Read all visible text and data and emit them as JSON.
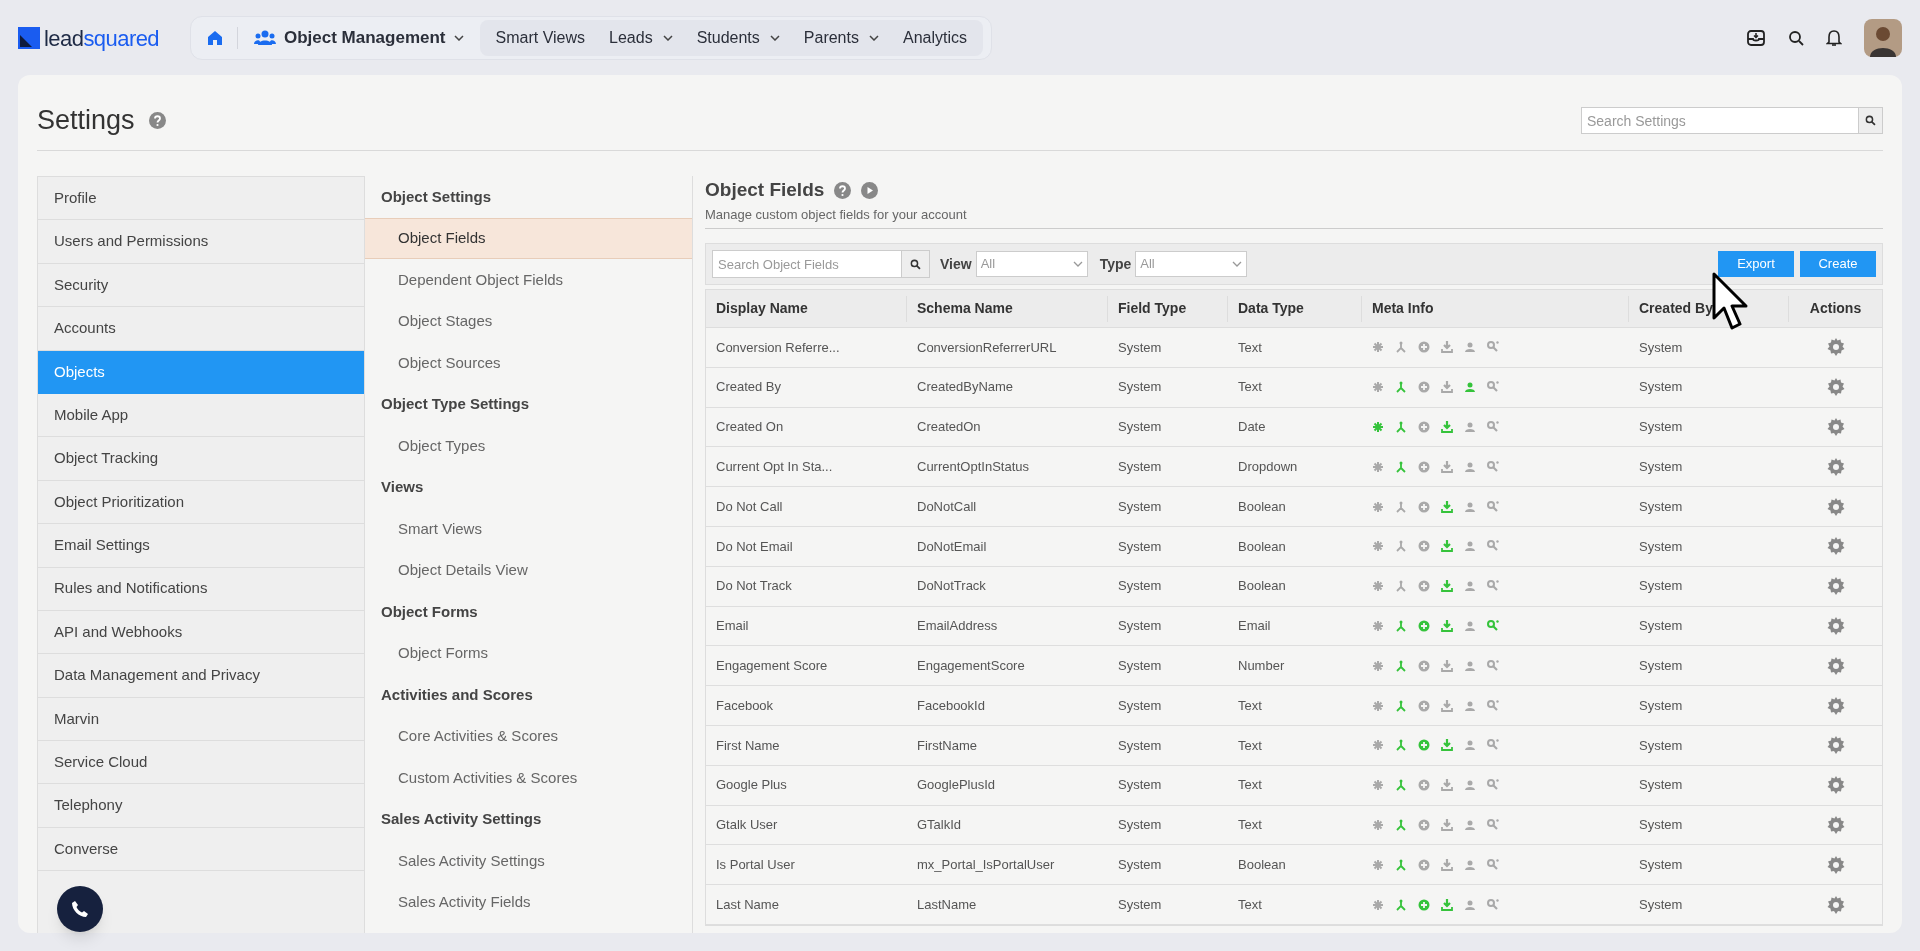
{
  "brand": {
    "part1": "lead",
    "part2": "squared"
  },
  "nav": {
    "module": "Object Management",
    "items": [
      {
        "label": "Smart Views",
        "dropdown": false
      },
      {
        "label": "Leads",
        "dropdown": true
      },
      {
        "label": "Students",
        "dropdown": true
      },
      {
        "label": "Parents",
        "dropdown": true
      },
      {
        "label": "Analytics",
        "dropdown": false
      }
    ]
  },
  "page": {
    "title": "Settings",
    "search": {
      "placeholder": "Search Settings"
    }
  },
  "sidebar": {
    "items": [
      {
        "label": "Profile",
        "selected": false
      },
      {
        "label": "Users and Permissions",
        "selected": false
      },
      {
        "label": "Security",
        "selected": false
      },
      {
        "label": "Accounts",
        "selected": false
      },
      {
        "label": "Objects",
        "selected": true
      },
      {
        "label": "Mobile App",
        "selected": false
      },
      {
        "label": "Object Tracking",
        "selected": false
      },
      {
        "label": "Object Prioritization",
        "selected": false
      },
      {
        "label": "Email Settings",
        "selected": false
      },
      {
        "label": "Rules and Notifications",
        "selected": false
      },
      {
        "label": "API and Webhooks",
        "selected": false
      },
      {
        "label": "Data Management and Privacy",
        "selected": false
      },
      {
        "label": "Marvin",
        "selected": false
      },
      {
        "label": "Service Cloud",
        "selected": false
      },
      {
        "label": "Telephony",
        "selected": false
      },
      {
        "label": "Converse",
        "selected": false
      }
    ]
  },
  "submenu": {
    "items": [
      {
        "kind": "heading",
        "label": "Object Settings"
      },
      {
        "kind": "item",
        "label": "Object Fields",
        "selected": true
      },
      {
        "kind": "item",
        "label": "Dependent Object Fields",
        "selected": false
      },
      {
        "kind": "item",
        "label": "Object Stages",
        "selected": false
      },
      {
        "kind": "item",
        "label": "Object Sources",
        "selected": false
      },
      {
        "kind": "heading",
        "label": "Object Type Settings"
      },
      {
        "kind": "item",
        "label": "Object Types",
        "selected": false
      },
      {
        "kind": "heading",
        "label": "Views"
      },
      {
        "kind": "item",
        "label": "Smart Views",
        "selected": false
      },
      {
        "kind": "item",
        "label": "Object Details View",
        "selected": false
      },
      {
        "kind": "heading",
        "label": "Object Forms"
      },
      {
        "kind": "item",
        "label": "Object Forms",
        "selected": false
      },
      {
        "kind": "heading",
        "label": "Activities and Scores"
      },
      {
        "kind": "item",
        "label": "Core Activities & Scores",
        "selected": false
      },
      {
        "kind": "item",
        "label": "Custom Activities & Scores",
        "selected": false
      },
      {
        "kind": "heading",
        "label": "Sales Activity Settings"
      },
      {
        "kind": "item",
        "label": "Sales Activity Settings",
        "selected": false
      },
      {
        "kind": "item",
        "label": "Sales Activity Fields",
        "selected": false
      }
    ]
  },
  "content": {
    "title": "Object Fields",
    "subtitle": "Manage custom object fields for your account",
    "search": {
      "placeholder": "Search Object Fields"
    },
    "filters": [
      {
        "label": "View",
        "value": "All"
      },
      {
        "label": "Type",
        "value": "All"
      }
    ],
    "buttons": [
      "Export",
      "Create"
    ],
    "table": {
      "columns": [
        "Display Name",
        "Schema Name",
        "Field Type",
        "Data Type",
        "Meta Info",
        "Created By",
        "Actions"
      ],
      "rows": [
        {
          "display_name": "Conversion Referre...",
          "schema_name": "ConversionReferrerURL",
          "field_type": "System",
          "data_type": "Text",
          "meta_info": [
            false,
            false,
            false,
            false,
            false,
            false
          ],
          "created_by": "System"
        },
        {
          "display_name": "Created By",
          "schema_name": "CreatedByName",
          "field_type": "System",
          "data_type": "Text",
          "meta_info": [
            false,
            true,
            false,
            false,
            true,
            false
          ],
          "created_by": "System"
        },
        {
          "display_name": "Created On",
          "schema_name": "CreatedOn",
          "field_type": "System",
          "data_type": "Date",
          "meta_info": [
            true,
            true,
            false,
            true,
            false,
            false
          ],
          "created_by": "System"
        },
        {
          "display_name": "Current Opt In Sta...",
          "schema_name": "CurrentOptInStatus",
          "field_type": "System",
          "data_type": "Dropdown",
          "meta_info": [
            false,
            true,
            false,
            false,
            false,
            false
          ],
          "created_by": "System"
        },
        {
          "display_name": "Do Not Call",
          "schema_name": "DoNotCall",
          "field_type": "System",
          "data_type": "Boolean",
          "meta_info": [
            false,
            false,
            false,
            true,
            false,
            false
          ],
          "created_by": "System"
        },
        {
          "display_name": "Do Not Email",
          "schema_name": "DoNotEmail",
          "field_type": "System",
          "data_type": "Boolean",
          "meta_info": [
            false,
            false,
            false,
            true,
            false,
            false
          ],
          "created_by": "System"
        },
        {
          "display_name": "Do Not Track",
          "schema_name": "DoNotTrack",
          "field_type": "System",
          "data_type": "Boolean",
          "meta_info": [
            false,
            false,
            false,
            true,
            false,
            false
          ],
          "created_by": "System"
        },
        {
          "display_name": "Email",
          "schema_name": "EmailAddress",
          "field_type": "System",
          "data_type": "Email",
          "meta_info": [
            false,
            true,
            true,
            true,
            false,
            true
          ],
          "created_by": "System"
        },
        {
          "display_name": "Engagement Score",
          "schema_name": "EngagementScore",
          "field_type": "System",
          "data_type": "Number",
          "meta_info": [
            false,
            true,
            false,
            false,
            false,
            false
          ],
          "created_by": "System"
        },
        {
          "display_name": "Facebook",
          "schema_name": "FacebookId",
          "field_type": "System",
          "data_type": "Text",
          "meta_info": [
            false,
            true,
            false,
            false,
            false,
            false
          ],
          "created_by": "System"
        },
        {
          "display_name": "First Name",
          "schema_name": "FirstName",
          "field_type": "System",
          "data_type": "Text",
          "meta_info": [
            false,
            true,
            true,
            true,
            false,
            false
          ],
          "created_by": "System"
        },
        {
          "display_name": "Google Plus",
          "schema_name": "GooglePlusId",
          "field_type": "System",
          "data_type": "Text",
          "meta_info": [
            false,
            true,
            false,
            false,
            false,
            false
          ],
          "created_by": "System"
        },
        {
          "display_name": "Gtalk User",
          "schema_name": "GTalkId",
          "field_type": "System",
          "data_type": "Text",
          "meta_info": [
            false,
            true,
            false,
            false,
            false,
            false
          ],
          "created_by": "System"
        },
        {
          "display_name": "Is Portal User",
          "schema_name": "mx_Portal_IsPortalUser",
          "field_type": "System",
          "data_type": "Boolean",
          "meta_info": [
            false,
            true,
            false,
            false,
            false,
            false
          ],
          "created_by": "System"
        },
        {
          "display_name": "Last Name",
          "schema_name": "LastName",
          "field_type": "System",
          "data_type": "Text",
          "meta_info": [
            false,
            true,
            true,
            true,
            false,
            false
          ],
          "created_by": "System"
        }
      ]
    }
  }
}
